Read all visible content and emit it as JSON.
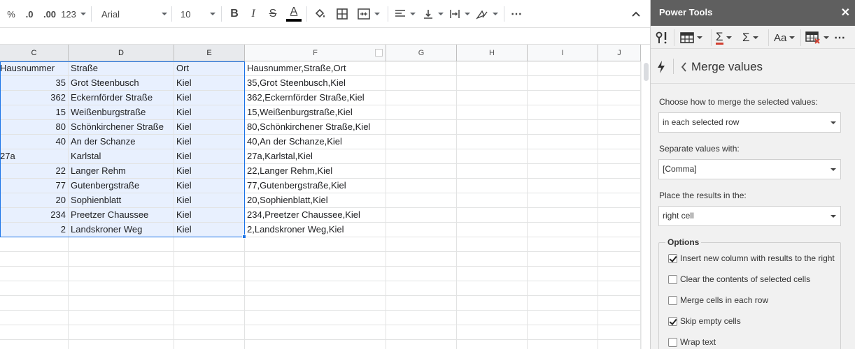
{
  "toolbar": {
    "percent": "%",
    "decimal_decrease": ".0",
    "decimal_increase": ".00",
    "number_format": "123",
    "font_family": "Arial",
    "font_size": "10",
    "bold": "B",
    "italic": "I",
    "strikethrough": "S",
    "text_color_letter": "A",
    "more": "⋯",
    "text_color": "#000000"
  },
  "sheet": {
    "columns": [
      "C",
      "D",
      "E",
      "F",
      "G",
      "H",
      "I",
      "J"
    ],
    "rows": [
      [
        "Hausnummer",
        "Straße",
        "Ort",
        "Hausnummer,Straße,Ort"
      ],
      [
        "35",
        "Grot Steenbusch",
        "Kiel",
        "35,Grot Steenbusch,Kiel"
      ],
      [
        "362",
        "Eckernförder Straße",
        "Kiel",
        "362,Eckernförder Straße,Kiel"
      ],
      [
        "15",
        "Weißenburgstraße",
        "Kiel",
        "15,Weißenburgstraße,Kiel"
      ],
      [
        "80",
        "Schönkirchener Straße",
        "Kiel",
        "80,Schönkirchener Straße,Kiel"
      ],
      [
        "40",
        "An der Schanze",
        "Kiel",
        "40,An der Schanze,Kiel"
      ],
      [
        "27a",
        "Karlstal",
        "Kiel",
        "27a,Karlstal,Kiel"
      ],
      [
        "22",
        "Langer Rehm",
        "Kiel",
        "22,Langer Rehm,Kiel"
      ],
      [
        "77",
        "Gutenbergstraße",
        "Kiel",
        "77,Gutenbergstraße,Kiel"
      ],
      [
        "20",
        "Sophienblatt",
        "Kiel",
        "20,Sophienblatt,Kiel"
      ],
      [
        "234",
        "Preetzer Chaussee",
        "Kiel",
        "234,Preetzer Chaussee,Kiel"
      ],
      [
        "2",
        "Landskroner Weg",
        "Kiel",
        "2,Landskroner Weg,Kiel"
      ]
    ],
    "selection_color": "#e8f0fe",
    "selection_border_color": "#1a73e8"
  },
  "panel": {
    "title": "Power Tools",
    "close": "✕",
    "tool_case": "Aa",
    "page_title": "Merge values",
    "merge_label": "Choose how to merge the selected values:",
    "merge_value": "in each selected row",
    "separator_label": "Separate values with:",
    "separator_value": "[Comma]",
    "place_label": "Place the results in the:",
    "place_value": "right cell",
    "options_title": "Options",
    "options": [
      {
        "label": "Insert new column with results to the right",
        "checked": true
      },
      {
        "label": "Clear the contents of selected cells",
        "checked": false
      },
      {
        "label": "Merge cells in each row",
        "checked": false
      },
      {
        "label": "Skip empty cells",
        "checked": true
      },
      {
        "label": "Wrap text",
        "checked": false
      }
    ],
    "header_color": "#5f5f5f"
  }
}
